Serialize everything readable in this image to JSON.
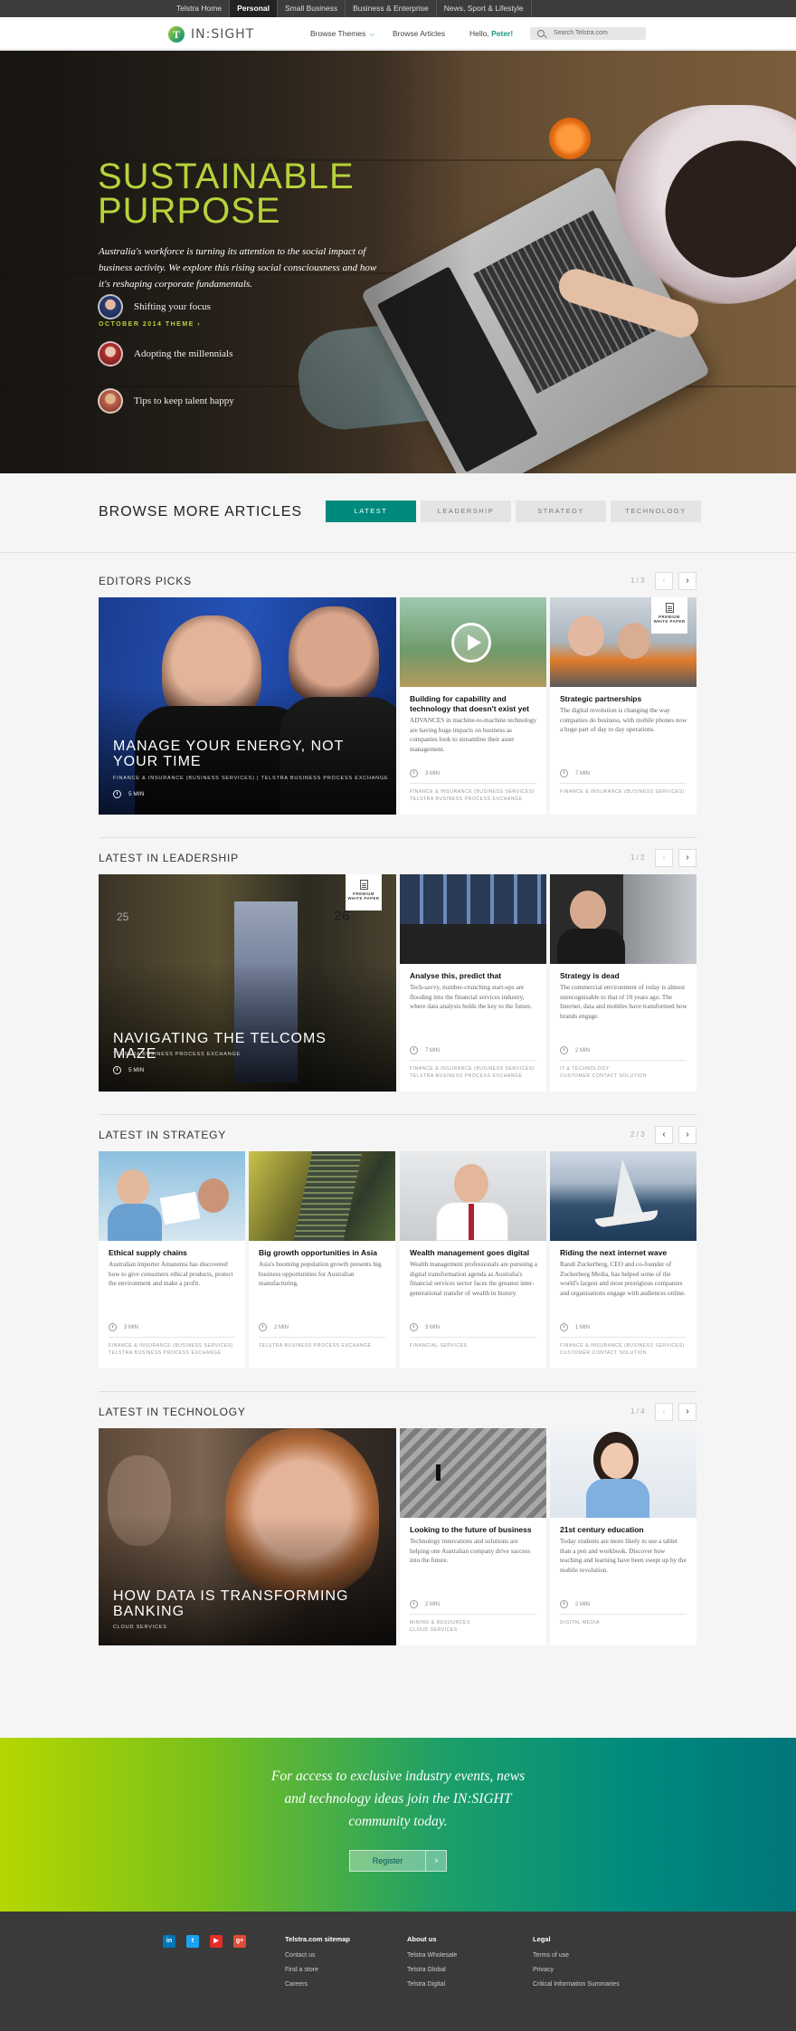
{
  "topbar": {
    "links": [
      "Telstra Home",
      "Personal",
      "Small Business",
      "Business & Enterprise",
      "News, Sport & Lifestyle"
    ],
    "active": 1
  },
  "header": {
    "logo_letter": "T",
    "logo_text": "IN:SIGHT",
    "browse_themes": "Browse Themes",
    "browse_articles": "Browse Articles",
    "greeting": "Hello, ",
    "user": "Peter!",
    "search_placeholder": "Search Telstra.com"
  },
  "hero": {
    "title_line1": "SUSTAINABLE",
    "title_line2": "PURPOSE",
    "subtitle": "Australia's workforce is turning its attention to the social impact of business activity. We explore this rising social consciousness and how it's reshaping corporate fundamentals.",
    "theme": "OCTOBER 2014 THEME  ›",
    "items": [
      "Shifting your focus",
      "Adopting the millennials",
      "Tips to keep talent happy"
    ]
  },
  "browse": {
    "title": "BROWSE MORE ARTICLES",
    "tabs": [
      "LATEST",
      "LEADERSHIP",
      "STRATEGY",
      "TECHNOLOGY"
    ]
  },
  "sections": {
    "editors": {
      "title": "EDITORS PICKS",
      "pager": "1 / 3",
      "feature": {
        "title": "MANAGE YOUR ENERGY, NOT YOUR TIME",
        "category": "FINANCE & INSURANCE (BUSINESS SERVICES)  |  TELSTRA BUSINESS PROCESS EXCHANGE",
        "time": "5 MIN"
      },
      "cards": [
        {
          "title": "Building for capability and technology that doesn't exist yet",
          "desc": "ADVANCES in machine-to-machine technology are having huge impacts on business as companies look to streamline their asset management.",
          "time": "3 MIN",
          "category": "FINANCE & INSURANCE (BUSINESS SERVICES)\nTELSTRA BUSINESS PROCESS EXCHANGE"
        },
        {
          "title": "Strategic partnerships",
          "desc": "The digital revolution is changing the way companies do business, with mobile phones now a huge part of day to day operations.",
          "time": "7 MIN",
          "category": "FINANCE & INSURANCE (BUSINESS SERVICES)",
          "badge": "PREMIUM\nWHITE PAPER"
        }
      ]
    },
    "leadership": {
      "title": "LATEST IN LEADERSHIP",
      "pager": "1 / 2",
      "feature": {
        "title": "NAVIGATING THE TELCOMS MAZE",
        "category": "TELSTRA BUSINESS PROCESS EXCHANGE",
        "time": "5 MIN",
        "badge": "PREMIUM\nWHITE PAPER"
      },
      "cards": [
        {
          "title": "Analyse this, predict that",
          "desc": "Tech-savvy, number-crunching start-ups are flooding into the financial services industry, where data analysis holds the key to the future.",
          "time": "7 MIN",
          "category": "FINANCE & INSURANCE (BUSINESS SERVICES)\nTELSTRA BUSINESS PROCESS EXCHANGE"
        },
        {
          "title": "Strategy is dead",
          "desc": "The commercial environment of today is almost unrecognisable to that of 10 years ago. The Internet, data and mobiles have transformed how brands engage.",
          "time": "2 MIN",
          "category": "IT & TECHNOLOGY\nCUSTOMER CONTACT SOLUTION"
        }
      ]
    },
    "strategy": {
      "title": "LATEST IN STRATEGY",
      "pager": "2 / 3",
      "cards": [
        {
          "title": "Ethical supply chains",
          "desc": "Australian importer Amanenta has discovered how to give consumers ethical products, protect the environment and make a profit.",
          "time": "3 MIN",
          "category": "FINANCE & INSURANCE (BUSINESS SERVICES)\nTELSTRA BUSINESS PROCESS EXCHANGE"
        },
        {
          "title": "Big growth opportunities in Asia",
          "desc": "Asia's booming population growth presents big business opportunities for Australian manufacturing.",
          "time": "2 MIN",
          "category": "TELSTRA BUSINESS PROCESS EXCHANGE"
        },
        {
          "title": "Wealth management goes digital",
          "desc": "Wealth management professionals are pursuing a digital transformation agenda as Australia's financial services sector faces the greatest inter-generational transfer of wealth in history.",
          "time": "3 MIN",
          "category": "FINANCIAL SERVICES"
        },
        {
          "title": "Riding the next internet wave",
          "desc": "Randi Zuckerberg, CEO and co-founder of Zuckerberg Media, has helped some of the world's largest and most prestigious companies and organisations engage with audiences online.",
          "time": "1 MIN",
          "category": "FINANCE & INSURANCE (BUSINESS SERVICES)\nCUSTOMER CONTACT SOLUTION"
        }
      ]
    },
    "technology": {
      "title": "LATEST IN TECHNOLOGY",
      "pager": "1 / 4",
      "feature": {
        "title": "HOW DATA IS TRANSFORMING BANKING",
        "category": "CLOUD SERVICES"
      },
      "cards": [
        {
          "title": "Looking to the future of business",
          "desc": "Technology innovations and solutions are helping one Australian company drive success into the future.",
          "time": "2 MIN",
          "category": "MINING & RESOURCES\nCLOUD SERVICES"
        },
        {
          "title": "21st century education",
          "desc": "Today students are more likely to use a tablet than a pen and workbook. Discover how teaching and learning have been swept up by the mobile revolution.",
          "time": "2 MIN",
          "category": "DIGITAL MEDIA"
        }
      ]
    }
  },
  "cta": {
    "text": "For access to exclusive industry events, news and technology ideas join the IN:SIGHT community today.",
    "button": "Register",
    "arrow": "›"
  },
  "footer": {
    "social": [
      {
        "label": "in",
        "color": "#0077b5"
      },
      {
        "label": "t",
        "color": "#1da1f2"
      },
      {
        "label": "▶",
        "color": "#e52d27"
      },
      {
        "label": "g+",
        "color": "#dd4b39"
      }
    ],
    "cols": [
      {
        "heading": "Telstra.com sitemap",
        "links": [
          "Contact us",
          "Find a store",
          "Careers"
        ]
      },
      {
        "heading": "About us",
        "links": [
          "Telstra Wholesale",
          "Telstra Global",
          "Telstra Digital"
        ]
      },
      {
        "heading": "Legal",
        "links": [
          "Terms of use",
          "Privacy",
          "Critical Information Summaries"
        ]
      }
    ]
  },
  "colors": {
    "accent": "#008a7e",
    "lime": "#b6d33a"
  }
}
